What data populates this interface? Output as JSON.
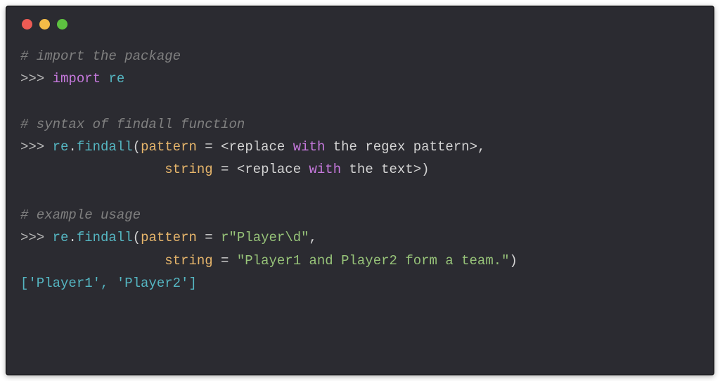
{
  "window_controls": {
    "red": "close",
    "yellow": "minimize",
    "green": "maximize"
  },
  "lines": {
    "c1": "# import the package",
    "p1": ">>> ",
    "import_kw": "import",
    "import_sp": " ",
    "import_mod": "re",
    "c2": "# syntax of findall function",
    "p2": ">>> ",
    "l2_mod": "re",
    "l2_dot": ".",
    "l2_fn": "findall",
    "l2_open": "(",
    "l2_param1": "pattern",
    "l2_eq1": " = ",
    "l2_lt1": "<",
    "l2_r1a": "replace ",
    "l2_with": "with",
    "l2_r1b": " the regex pattern",
    "l2_gt1": ">",
    "l2_comma": ",",
    "l3_indent": "                  ",
    "l3_param": "string",
    "l3_eq": " = ",
    "l3_lt": "<",
    "l3_ra": "replace ",
    "l3_with": "with",
    "l3_rb": " the text",
    "l3_gt": ">",
    "l3_close": ")",
    "c3": "# example usage",
    "p3": ">>> ",
    "l4_mod": "re",
    "l4_dot": ".",
    "l4_fn": "findall",
    "l4_open": "(",
    "l4_param1": "pattern",
    "l4_eq1": " = ",
    "l4_str1": "r\"Player\\d\"",
    "l4_comma": ",",
    "l5_indent": "                  ",
    "l5_param": "string",
    "l5_eq": " = ",
    "l5_str": "\"Player1 and Player2 form a team.\"",
    "l5_close": ")",
    "output": "['Player1', 'Player2']"
  }
}
